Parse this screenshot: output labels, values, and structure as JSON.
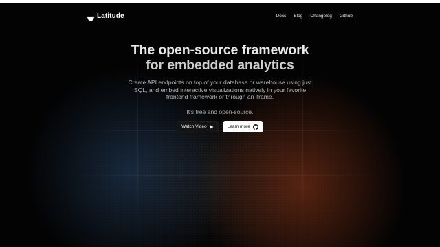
{
  "brand": {
    "name": "Latitude",
    "logo": "half-circle-logo"
  },
  "nav": {
    "links": [
      {
        "label": "Docs"
      },
      {
        "label": "Blog"
      },
      {
        "label": "Changelog"
      },
      {
        "label": "Github"
      }
    ]
  },
  "hero": {
    "title_line1": "The open-source framework",
    "title_line2": "for embedded analytics",
    "subtitle": "Create API endpoints on top of your database or warehouse using just SQL, and embed interactive visualizations natively in your favorite frontend framework or through an iframe.",
    "free_note": "It's free and open-source.",
    "watch_video_label": "Watch Video",
    "watch_video_icon": "play-icon",
    "learn_more_label": "Learn more",
    "learn_more_icon": "github-icon"
  },
  "colors": {
    "background": "#030303",
    "text_primary": "#e8e8e8",
    "text_secondary": "#b8b8b8",
    "glow_blue": "#284669",
    "glow_orange": "#8c3719"
  }
}
